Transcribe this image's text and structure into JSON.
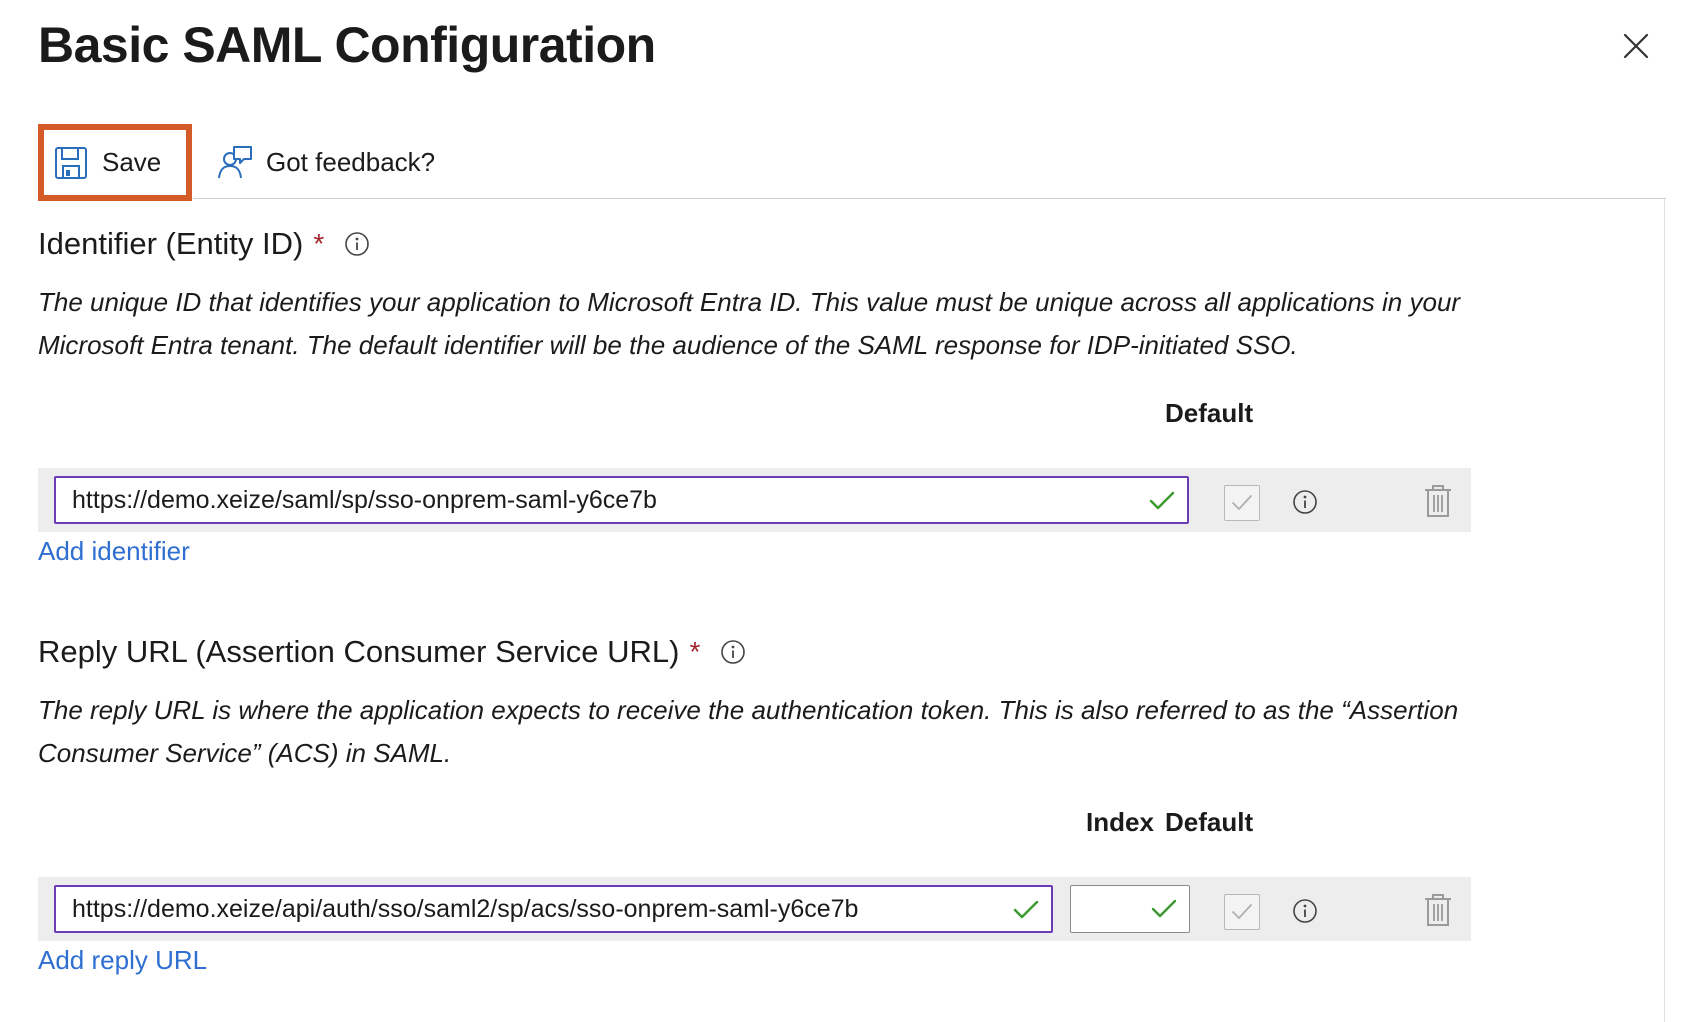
{
  "panel": {
    "title": "Basic SAML Configuration"
  },
  "toolbar": {
    "save_label": "Save",
    "feedback_label": "Got feedback?"
  },
  "identifier": {
    "heading": "Identifier (Entity ID)",
    "required_mark": "*",
    "description": "The unique ID that identifies your application to Microsoft Entra ID. This value must be unique across all applications in your Microsoft Entra tenant. The default identifier will be the audience of the SAML response for IDP-initiated SSO.",
    "columns": {
      "default": "Default"
    },
    "rows": [
      {
        "value": "https://demo.xeize/saml/sp/sso-onprem-saml-y6ce7b",
        "is_default": true
      }
    ],
    "add_label": "Add identifier"
  },
  "reply_url": {
    "heading": "Reply URL (Assertion Consumer Service URL)",
    "required_mark": "*",
    "description": "The reply URL is where the application expects to receive the authentication token. This is also referred to as the “Assertion Consumer Service” (ACS) in SAML.",
    "columns": {
      "index": "Index",
      "default": "Default"
    },
    "rows": [
      {
        "value": "https://demo.xeize/api/auth/sso/saml2/sp/acs/sso-onprem-saml-y6ce7b",
        "index": "",
        "is_default": true
      }
    ],
    "add_label": "Add reply URL"
  },
  "colors": {
    "highlight_border": "#d45a28",
    "input_border": "#6c3cb4",
    "valid_check": "#3a9a2f",
    "link": "#2f6fd1",
    "required": "#a4262c",
    "row_background": "#ededed"
  },
  "icons": {
    "close": "close-icon",
    "save": "floppy-disk-icon",
    "feedback": "feedback-person-icon",
    "info": "info-icon",
    "valid": "checkmark-icon",
    "delete": "trash-icon"
  }
}
